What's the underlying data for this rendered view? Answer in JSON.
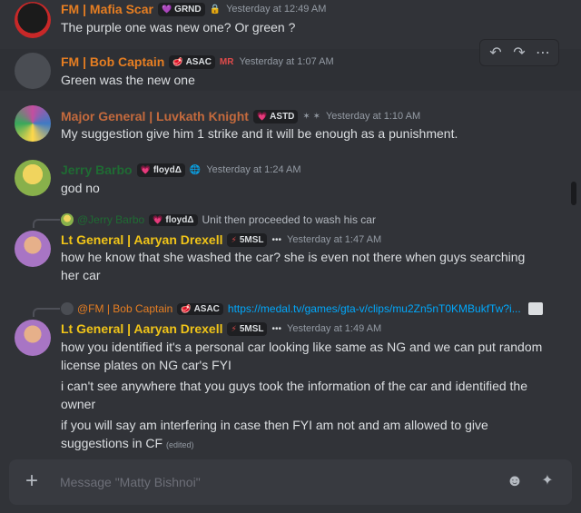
{
  "colors": {
    "background": "#313338",
    "composer_bg": "#383a40",
    "link": "#00a8fc"
  },
  "messages": [
    {
      "username": "FM | Mafia Scar",
      "name_color": "#e67e22",
      "tag": "GRND",
      "tag_icon": "💜",
      "extra": "🔒",
      "timestamp": "Yesterday at 12:49 AM",
      "lines": [
        "The purple one was new one? Or green ?"
      ]
    },
    {
      "username": "FM | Bob Captain",
      "name_color": "#e67e22",
      "tag": "ASAC",
      "tag_icon": "🥩",
      "extra": "MR",
      "timestamp": "Yesterday at 1:07 AM",
      "lines": [
        "Green was the new one"
      ]
    },
    {
      "username": "Major General | Luvkath  Knight",
      "name_color": "#c46a3d",
      "tag": "ASTD",
      "tag_icon": "💗",
      "extra": "✶ ✶",
      "timestamp": "Yesterday at 1:10 AM",
      "lines": [
        "My suggestion give him 1 strike and it will be enough as a punishment."
      ]
    },
    {
      "username": "Jerry Barbo",
      "name_color": "#1f6b33",
      "tag": "floydΔ",
      "tag_icon": "💗",
      "extra": "🌐",
      "timestamp": "Yesterday at 1:24 AM",
      "lines": [
        "god no"
      ]
    },
    {
      "reply": {
        "username": "@Jerry Barbo",
        "tag": "floydΔ",
        "text": "Unit then proceeded to wash his car"
      },
      "username": "Lt General | Aaryan Drexell",
      "name_color": "#f0c419",
      "tag": "5MSL",
      "tag_icon": "⚡",
      "extra": "•••",
      "timestamp": "Yesterday at 1:47 AM",
      "lines": [
        "how he know that she washed the car? she is even not there when guys searching her car"
      ]
    },
    {
      "reply": {
        "username": "@FM | Bob Captain",
        "tag": "ASAC",
        "text": "https://medal.tv/games/gta-v/clips/mu2Zn5nT0KMBukfTw?i..."
      },
      "username": "Lt General | Aaryan Drexell",
      "name_color": "#f0c419",
      "tag": "5MSL",
      "tag_icon": "⚡",
      "extra": "•••",
      "timestamp": "Yesterday at 1:49 AM",
      "lines": [
        "how you identified it's a personal car looking like same as NG and we can put random license plates on NG car's FYI",
        "i can't see anywhere that you guys took the information of the car and identified the owner",
        "if you will say am interfering in case then FYI am not and am allowed to give suggestions in CF"
      ],
      "edited": "(edited)"
    }
  ],
  "toolbar": {
    "reply_icon": "↶",
    "forward_icon": "↷",
    "more_icon": "⋯"
  },
  "composer": {
    "placeholder": "Message \"Matty Bishnoi\"",
    "plus_icon": "+",
    "emoji_icon": "☻",
    "apps_icon": "✦"
  }
}
